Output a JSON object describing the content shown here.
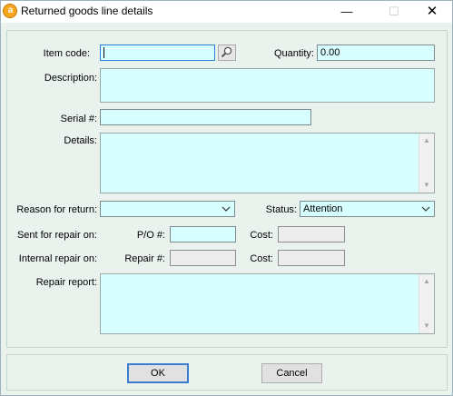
{
  "window": {
    "title": "Returned goods line details",
    "icon": "app-logo-icon",
    "icon_letter": "a",
    "controls": {
      "minimize": "—",
      "maximize": "☐",
      "close": "✕"
    }
  },
  "form": {
    "item_code": {
      "label": "Item code:",
      "value": ""
    },
    "quantity": {
      "label": "Quantity:",
      "value": "0.00"
    },
    "description": {
      "label": "Description:",
      "value": ""
    },
    "serial": {
      "label": "Serial #:",
      "value": ""
    },
    "details": {
      "label": "Details:",
      "value": ""
    },
    "reason_for_return": {
      "label": "Reason for return:",
      "value": ""
    },
    "status": {
      "label": "Status:",
      "value": "Attention"
    },
    "sent_for_repair": {
      "label": "Sent for repair on:",
      "po_label": "P/O #:",
      "po_value": "",
      "cost_label": "Cost:",
      "cost_value": ""
    },
    "internal_repair": {
      "label": "Internal repair on:",
      "repair_label": "Repair #:",
      "repair_value": "",
      "cost_label": "Cost:",
      "cost_value": ""
    },
    "repair_report": {
      "label": "Repair report:",
      "value": ""
    }
  },
  "buttons": {
    "ok": "OK",
    "cancel": "Cancel"
  },
  "colors": {
    "field_bg": "#d7ffff",
    "window_bg": "#eaf2ee",
    "default_button_border": "#3c7ccf",
    "icon_orange": "#f7a51d"
  }
}
